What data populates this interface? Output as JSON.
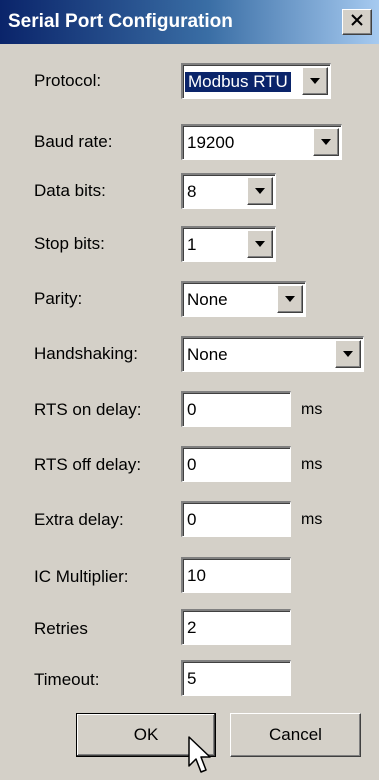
{
  "window": {
    "title": "Serial Port Configuration",
    "close_icon": "close-icon"
  },
  "fields": {
    "protocol": {
      "label": "Protocol:",
      "value": "Modbus RTU",
      "selected": true
    },
    "baud_rate": {
      "label": "Baud rate:",
      "value": "19200"
    },
    "data_bits": {
      "label": "Data bits:",
      "value": "8"
    },
    "stop_bits": {
      "label": "Stop bits:",
      "value": "1"
    },
    "parity": {
      "label": "Parity:",
      "value": "None"
    },
    "handshaking": {
      "label": "Handshaking:",
      "value": "None"
    },
    "rts_on_delay": {
      "label": "RTS on delay:",
      "value": "0",
      "unit": "ms"
    },
    "rts_off_delay": {
      "label": "RTS off delay:",
      "value": "0",
      "unit": "ms"
    },
    "extra_delay": {
      "label": "Extra delay:",
      "value": "0",
      "unit": "ms"
    },
    "ic_multiplier": {
      "label": "IC Multiplier:",
      "value": "10"
    },
    "retries": {
      "label": "Retries",
      "value": "2"
    },
    "timeout": {
      "label": "Timeout:",
      "value": "5"
    }
  },
  "buttons": {
    "ok": "OK",
    "cancel": "Cancel"
  },
  "colors": {
    "titlebar_start": "#0a246a",
    "titlebar_end": "#a6caf0",
    "dialog_face": "#d4d0c8",
    "selection": "#0a246a"
  }
}
